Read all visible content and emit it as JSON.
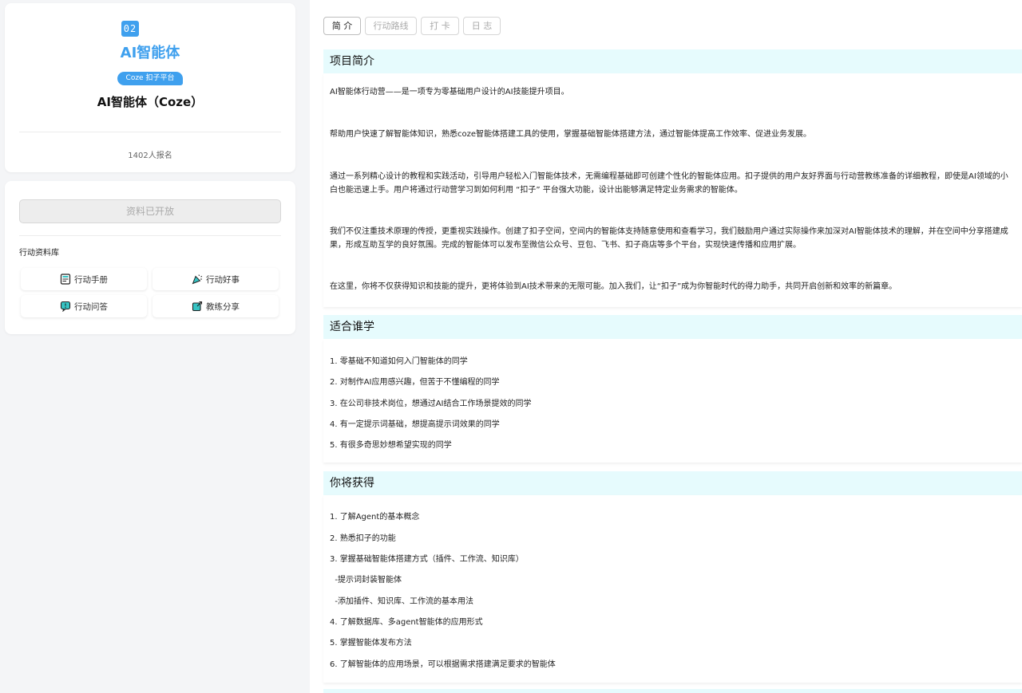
{
  "sidebar": {
    "number_badge": "02",
    "brand_title": "AI智能体",
    "platform_pill": "Coze 扣子平台",
    "course_title": "AI智能体（Coze）",
    "enroll_count": "1402人报名",
    "open_button": "资料已开放",
    "library_label": "行动资料库",
    "resources": [
      {
        "label": "行动手册",
        "icon": "handbook-icon"
      },
      {
        "label": "行动好事",
        "icon": "party-popper-icon"
      },
      {
        "label": "行动问答",
        "icon": "qa-icon"
      },
      {
        "label": "教练分享",
        "icon": "share-icon"
      }
    ]
  },
  "tabs": [
    "简 介",
    "行动路线",
    "打 卡",
    "日 志"
  ],
  "sections": {
    "intro": {
      "title": "项目简介",
      "paragraphs": [
        "AI智能体行动营——是一项专为零基础用户设计的AI技能提升项目。",
        "帮助用户快速了解智能体知识，熟悉coze智能体搭建工具的使用，掌握基础智能体搭建方法，通过智能体提高工作效率、促进业务发展。",
        "通过一系列精心设计的教程和实践活动，引导用户轻松入门智能体技术，无需编程基础即可创建个性化的智能体应用。扣子提供的用户友好界面与行动营教练准备的详细教程，即使是AI领域的小白也能迅速上手。用户将通过行动营学习到如何利用 “扣子” 平台强大功能，设计出能够满足特定业务需求的智能体。",
        "我们不仅注重技术原理的传授，更重视实践操作。创建了扣子空间，空间内的智能体支持随意使用和查看学习，我们鼓励用户通过实际操作来加深对AI智能体技术的理解，并在空间中分享搭建成果，形成互助互学的良好氛围。完成的智能体可以发布至微信公众号、豆包、飞书、扣子商店等多个平台，实现快速传播和应用扩展。",
        "在这里，你将不仅获得知识和技能的提升，更将体验到AI技术带来的无限可能。加入我们，让“扣子”成为你智能时代的得力助手，共同开启创新和效率的新篇章。"
      ]
    },
    "audience": {
      "title": "适合谁学",
      "items": [
        "1. 零基础不知道如何入门智能体的同学",
        "2. 对制作AI应用感兴趣，但苦于不懂编程的同学",
        "3. 在公司非技术岗位，想通过AI结合工作场景提效的同学",
        "4. 有一定提示词基础，想提高提示词效果的同学",
        "5. 有很多奇思妙想希望实现的同学"
      ]
    },
    "gains": {
      "title": "你将获得",
      "items": [
        "1. 了解Agent的基本概念",
        "2. 熟悉扣子的功能",
        "3. 掌握基础智能体搭建方式（插件、工作流、知识库）",
        "  -提示词封装智能体",
        "  -添加插件、知识库、工作流的基本用法",
        "4. 了解数据库、多agent智能体的应用形式",
        "5. 掌握智能体发布方法",
        "6. 了解智能体的应用场景，可以根据需求搭建满足要求的智能体"
      ]
    }
  },
  "colors": {
    "accent": "#3fa0ee",
    "section_bg": "#e6fbfd",
    "page_bg": "#f4f5f7"
  }
}
